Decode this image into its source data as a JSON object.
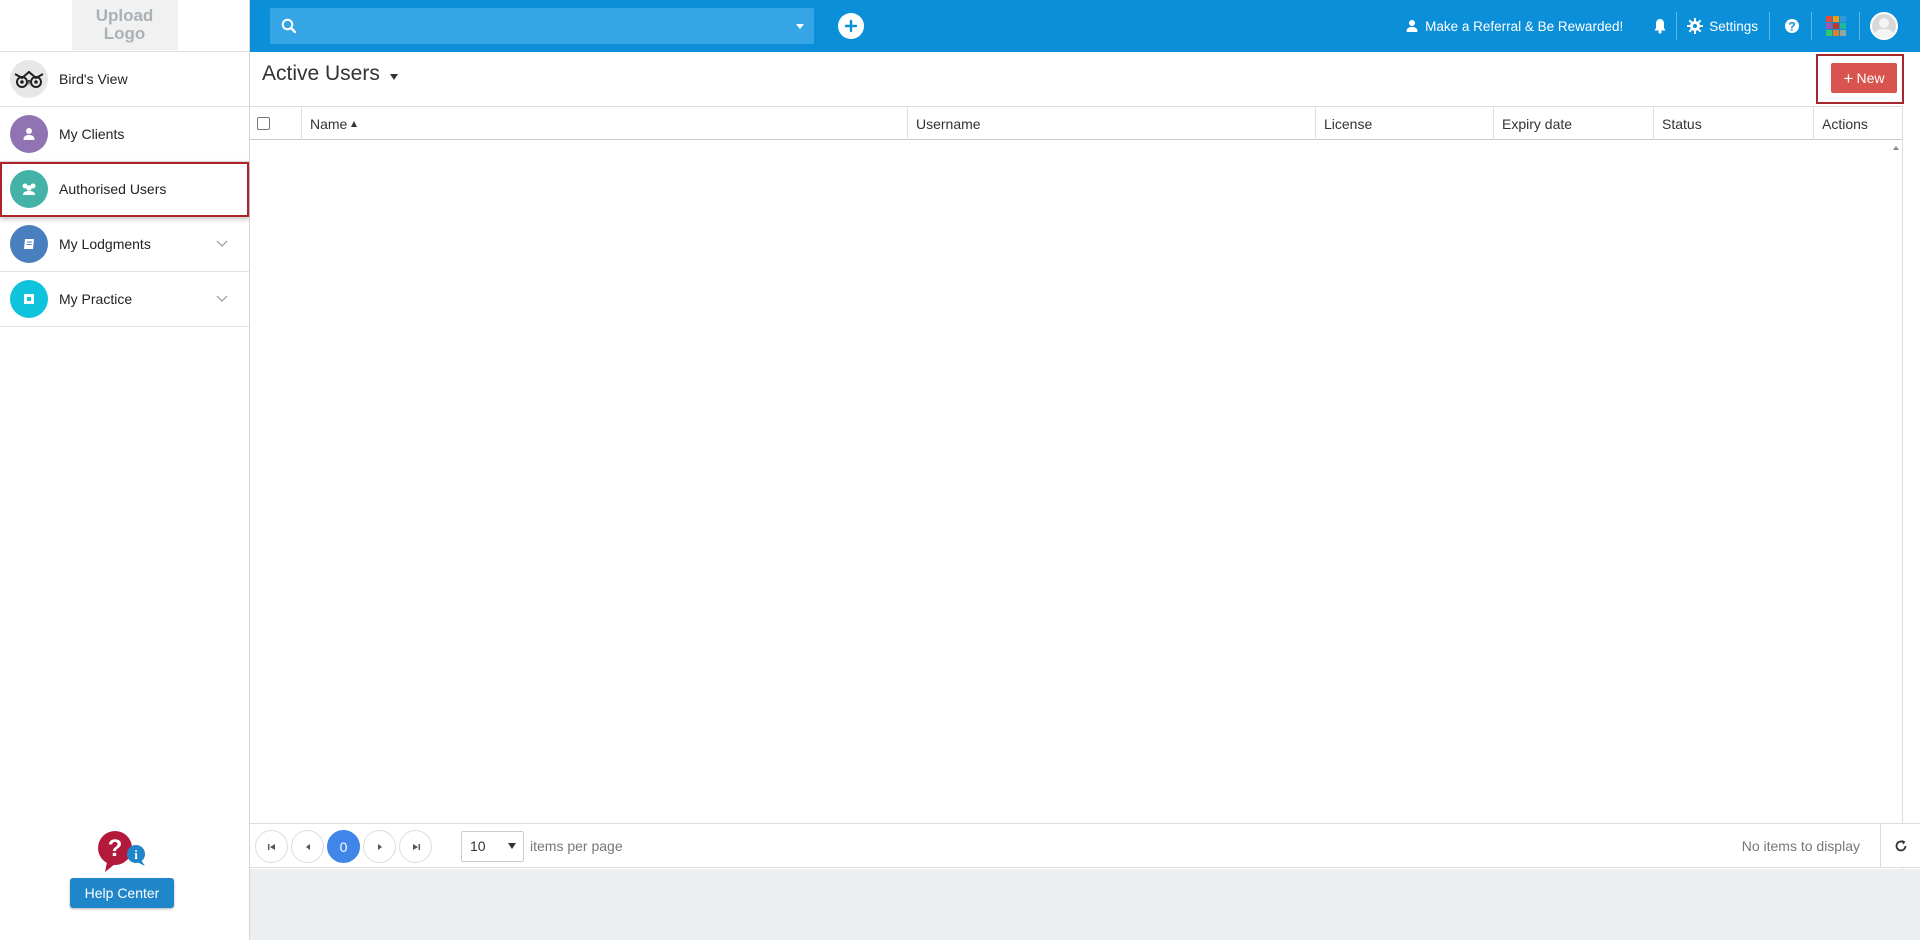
{
  "logo": {
    "text_line1": "Upload",
    "text_line2": "Logo"
  },
  "sidebar": {
    "items": [
      {
        "label": "Bird's View",
        "icon": "owl-icon",
        "color": "#e7e7e7"
      },
      {
        "label": "My Clients",
        "icon": "user-icon",
        "color": "#8f73b3"
      },
      {
        "label": "Authorised Users",
        "icon": "users-group-icon",
        "color": "#44b2a6",
        "active": true
      },
      {
        "label": "My Lodgments",
        "icon": "book-icon",
        "color": "#4a7fbf",
        "expandable": true
      },
      {
        "label": "My Practice",
        "icon": "practice-icon",
        "color": "#10c3dc",
        "expandable": true
      }
    ],
    "help_center_label": "Help Center"
  },
  "header": {
    "search_placeholder": "",
    "referral_label": "Make a Referral & Be Rewarded!",
    "settings_label": "Settings",
    "colors": {
      "bar": "#0c8fd9",
      "search": "#36a5e6"
    }
  },
  "main": {
    "title": "Active Users",
    "new_button_label": "New",
    "columns": [
      "Name",
      "Username",
      "License",
      "Expiry date",
      "Status",
      "Actions"
    ],
    "rows": [],
    "pager": {
      "current_page": "0",
      "page_size": "10",
      "items_per_page_label": "items per page",
      "empty_message": "No items to display"
    },
    "colors": {
      "new_button": "#d9534f",
      "highlight": "#a5262c",
      "page_active": "#3f86e8"
    }
  }
}
